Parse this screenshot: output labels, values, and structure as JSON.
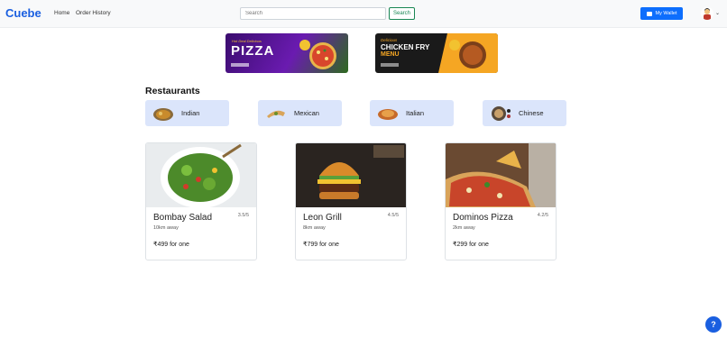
{
  "navbar": {
    "brand": "Cuebe",
    "links": [
      "Home",
      "Order History"
    ],
    "search_placeholder": "Search",
    "search_button": "Search",
    "wallet_button": "My Wallet"
  },
  "banners": [
    {
      "top_text": "Hot Deal Delicious",
      "headline": "PIZZA"
    },
    {
      "top_text": "Delicious",
      "headline": "CHICKEN FRY",
      "sub": "MENU"
    }
  ],
  "section_title": "Restaurants",
  "categories": [
    {
      "label": "Indian"
    },
    {
      "label": "Mexican"
    },
    {
      "label": "Italian"
    },
    {
      "label": "Chinese"
    }
  ],
  "restaurants": [
    {
      "name": "Bombay Salad",
      "rating": "3.5/5",
      "distance": "10km away",
      "price": "₹499 for one"
    },
    {
      "name": "Leon Grill",
      "rating": "4.5/5",
      "distance": "8km away",
      "price": "₹799 for one"
    },
    {
      "name": "Dominos Pizza",
      "rating": "4.2/5",
      "distance": "2km away",
      "price": "₹299 for one"
    }
  ],
  "help_label": "?",
  "colors": {
    "brand": "#1a5fe0",
    "wallet": "#0d6efd",
    "search_outline": "#198754",
    "category_bg": "#dbe5fb"
  }
}
